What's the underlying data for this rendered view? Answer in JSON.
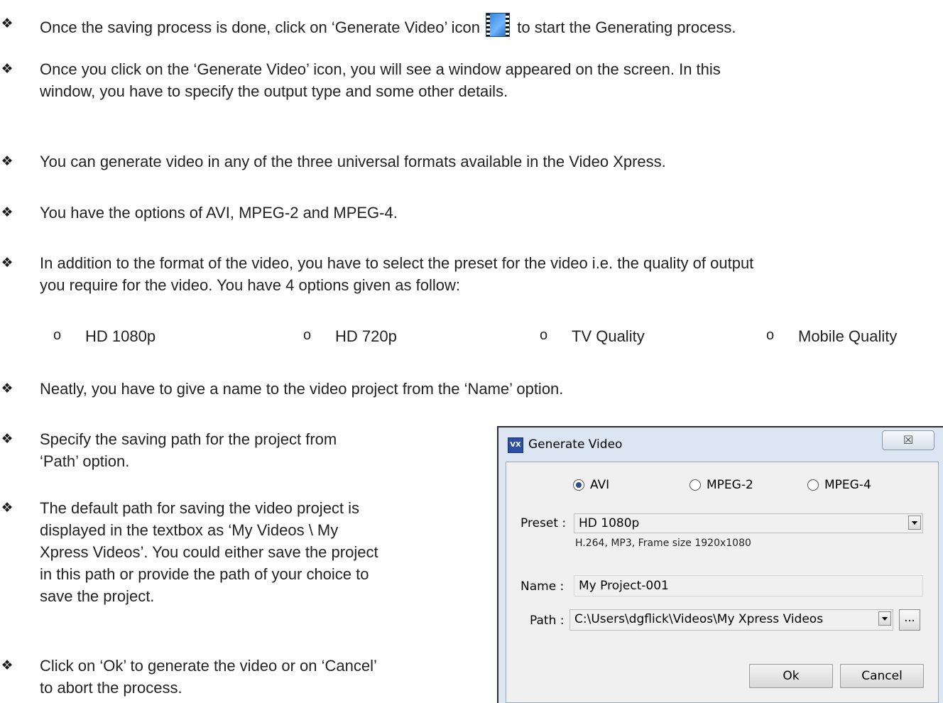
{
  "bullets": [
    {
      "pre": "Once the saving process is done, click on ‘Generate Video’ icon",
      "post": "to start the Generating process.",
      "icon": "film-icon"
    },
    {
      "line1": "Once you click on the ‘Generate Video’ icon, you will see a window appeared on the screen. In this",
      "line2": "window, you have to specify the output type and some other details."
    },
    {
      "line1": "You can generate video in any of the three universal formats available in the Video Xpress."
    },
    {
      "line1": "You have the options of AVI, MPEG-2 and MPEG-4."
    },
    {
      "line1": "In addition to the format of the video, you have to select the preset for the video i.e. the quality of output",
      "line2": "you require for the video. You have 4 options given as follow:"
    },
    {
      "line1": "Neatly, you have to give a name to the video project from the ‘Name’ option."
    },
    {
      "line1": "Specify the saving path for the project from",
      "line2": "‘Path’ option."
    },
    {
      "line1": "The default path for saving the video project is",
      "line2": "displayed in the textbox as ‘My Videos \\ My",
      "line3": "Xpress Videos’. You could either save the project",
      "line4": "in this path or provide the path of your choice to",
      "line5": "save the project."
    },
    {
      "line1": "Click on ‘Ok’ to generate the video or on ‘Cancel’",
      "line2": "to abort the process."
    }
  ],
  "bullet_mark": "❖",
  "sub_mark": "o",
  "preset_options": [
    "HD 1080p",
    "HD 720p",
    "TV Quality",
    "Mobile Quality"
  ],
  "dialog": {
    "app_icon": "VX",
    "title": "Generate Video",
    "close": "☒",
    "formats": [
      "AVI",
      "MPEG-2",
      "MPEG-4"
    ],
    "selected_format": "AVI",
    "preset_label": "Preset :",
    "preset_value": "HD 1080p",
    "preset_desc": "H.264, MP3, Frame size 1920x1080",
    "name_label": "Name :",
    "name_value": "My Project-001",
    "path_label": "Path :",
    "path_value": "C:\\Users\\dgflick\\Videos\\My Xpress Videos",
    "browse": "...",
    "ok": "Ok",
    "cancel": "Cancel"
  }
}
